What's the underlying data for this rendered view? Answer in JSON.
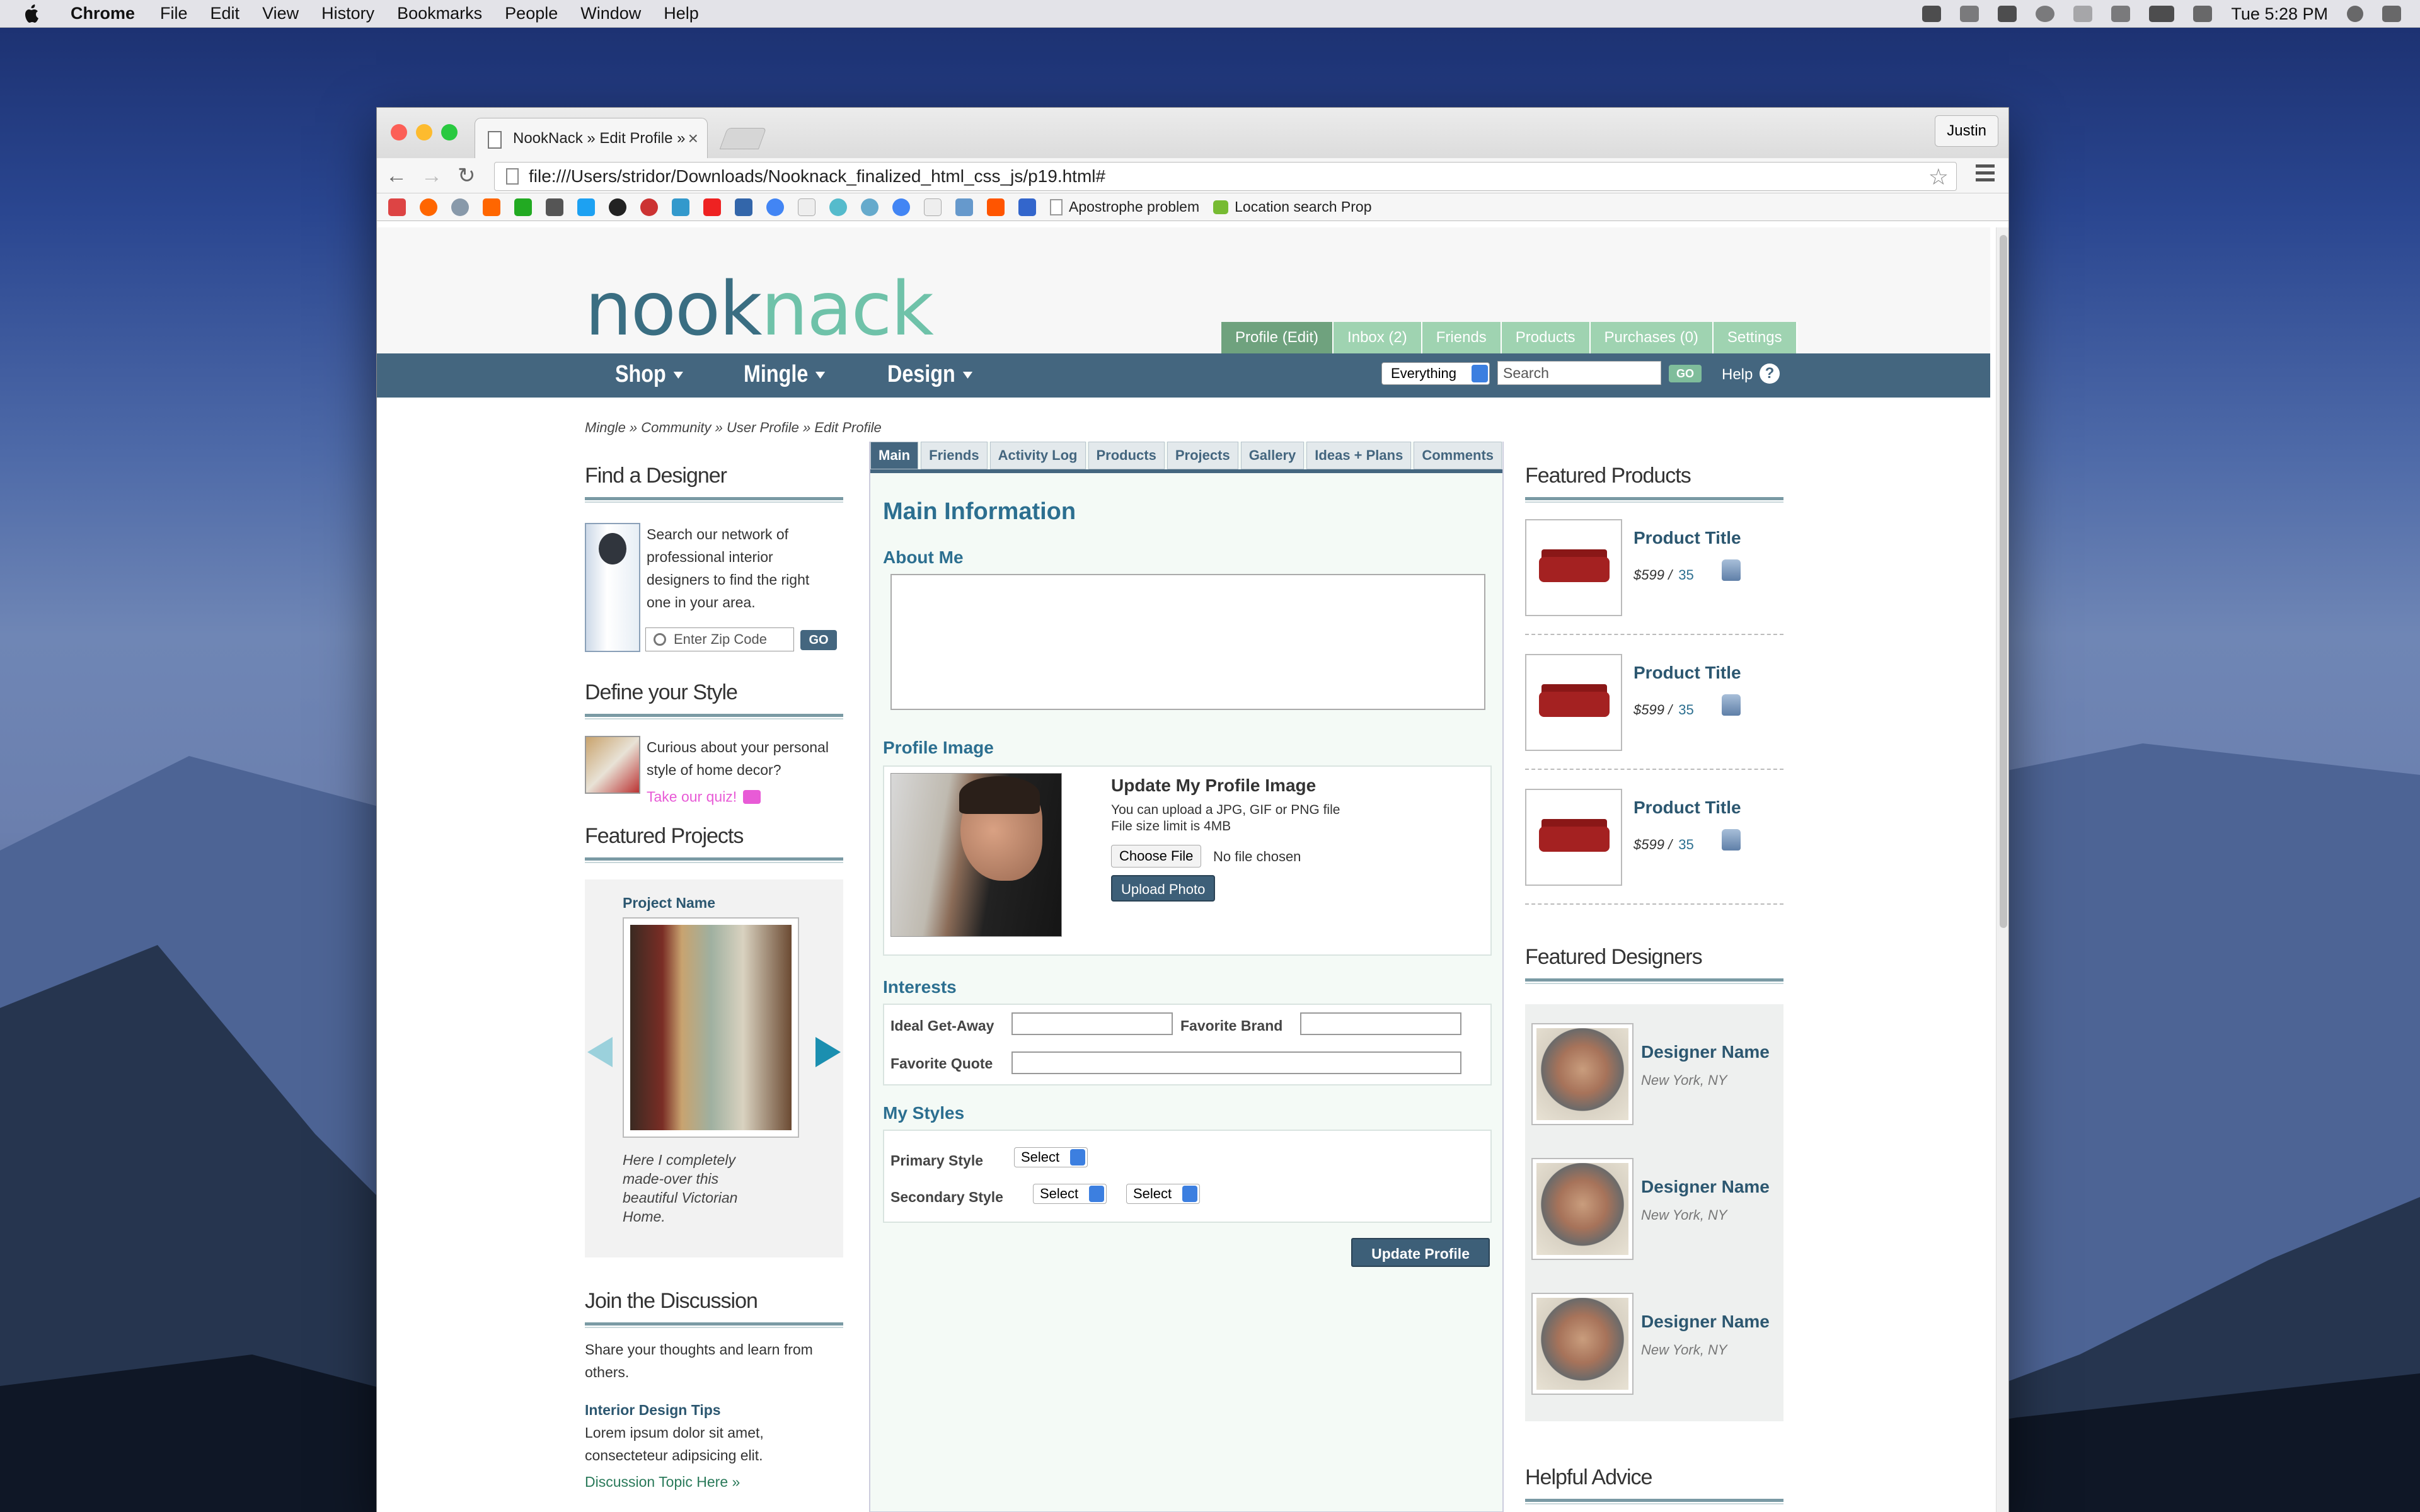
{
  "menubar": {
    "app": "Chrome",
    "items": [
      "File",
      "Edit",
      "View",
      "History",
      "Bookmarks",
      "People",
      "Window",
      "Help"
    ],
    "clock": "Tue 5:28 PM"
  },
  "browser": {
    "tab_title": "NookNack » Edit Profile » ",
    "user": "Justin",
    "url": "file:///Users/stridor/Downloads/Nooknack_finalized_html_css_js/p19.html#",
    "bookmarks": [
      "Apostrophe problem",
      "Location search Prop"
    ]
  },
  "site": {
    "logo_a": "nook",
    "logo_b": "nack",
    "profile_tabs": [
      "Profile (Edit)",
      "Inbox (2)",
      "Friends",
      "Products",
      "Purchases (0)",
      "Settings"
    ],
    "nav": [
      "Shop",
      "Mingle",
      "Design"
    ],
    "search_scope": "Everything",
    "search_placeholder": "Search",
    "go": "GO",
    "help": "Help",
    "help_icon": "?",
    "breadcrumb": "Mingle » Community » User Profile » Edit Profile"
  },
  "left": {
    "find_title": "Find a Designer",
    "find_text": "Search our network of professional interior designers to find the right one in your area.",
    "zip_placeholder": "Enter Zip Code",
    "zip_go": "GO",
    "style_title": "Define your Style",
    "style_text": "Curious about your personal style of home decor?",
    "quiz_link": "Take our quiz!",
    "projects_title": "Featured Projects",
    "project_name": "Project Name",
    "project_caption": "Here I completely made-over this beautiful Victorian Home.",
    "discussion_title": "Join the Discussion",
    "discussion_text": "Share your thoughts and learn from others.",
    "topic_title": "Interior Design Tips",
    "topic_text": "Lorem ipsum dolor sit amet, consecteteur adipsicing elit.",
    "topic_link": "Discussion Topic Here »"
  },
  "center": {
    "tabs": [
      "Main",
      "Friends",
      "Activity Log",
      "Products",
      "Projects",
      "Gallery",
      "Ideas + Plans",
      "Comments"
    ],
    "heading": "Main Information",
    "about_label": "About Me",
    "profile_image_label": "Profile Image",
    "update_title": "Update My Profile Image",
    "upload_note_1": "You can upload a JPG, GIF or PNG file",
    "upload_note_2": "File size limit is 4MB",
    "choose_file": "Choose File",
    "no_file": "No file chosen",
    "upload_photo": "Upload Photo",
    "interests_label": "Interests",
    "getaway_label": "Ideal Get-Away",
    "brand_label": "Favorite Brand",
    "quote_label": "Favorite Quote",
    "styles_label": "My Styles",
    "primary_label": "Primary Style",
    "secondary_label": "Secondary Style",
    "select": "Select",
    "update_profile": "Update Profile"
  },
  "right": {
    "products_title": "Featured Products",
    "products": [
      {
        "title": "Product Title",
        "price": "$599",
        "sep": "/",
        "likes": "35"
      },
      {
        "title": "Product Title",
        "price": "$599",
        "sep": "/",
        "likes": "35"
      },
      {
        "title": "Product Title",
        "price": "$599",
        "sep": "/",
        "likes": "35"
      }
    ],
    "designers_title": "Featured Designers",
    "designers": [
      {
        "name": "Designer Name",
        "location": "New York, NY"
      },
      {
        "name": "Designer Name",
        "location": "New York, NY"
      },
      {
        "name": "Designer Name",
        "location": "New York, NY"
      }
    ],
    "advice_title": "Helpful Advice"
  }
}
